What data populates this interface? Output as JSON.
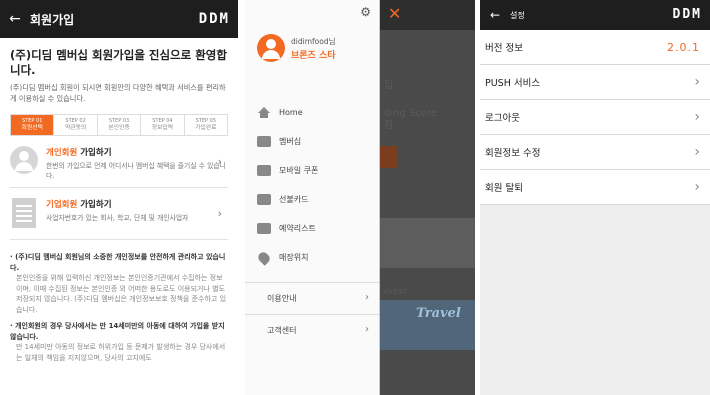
{
  "screen1": {
    "title": "회원가입",
    "logo": "DDM",
    "welcome_title": "(주)디딤 멤버십 회원가입을 진심으로 환영합니다.",
    "welcome_desc": "(주)디딤 멤버십 회원이 되시면 회원만의 다양한 혜택과 서비스를 편리하게 이용하실 수 있습니다.",
    "steps": [
      {
        "num": "STEP 01",
        "label": "회원선택"
      },
      {
        "num": "STEP 02",
        "label": "약관동의"
      },
      {
        "num": "STEP 03",
        "label": "본인인증"
      },
      {
        "num": "STEP 04",
        "label": "정보입력"
      },
      {
        "num": "STEP 05",
        "label": "가입완료"
      }
    ],
    "personal": {
      "hl": "개인회원",
      "rest": " 가입하기",
      "desc": "한번의 가입으로 언제 어디서나 멤버십 혜택을 즐기실 수 있습니다."
    },
    "corporate": {
      "hl": "기업회원",
      "rest": " 가입하기",
      "desc": "사업자번호가 있는 회사, 학교, 단체 및 개인사업자"
    },
    "privacy": [
      {
        "head": "· (주)디딤 멤버십 회원님의 소중한 개인정보를 안전하게 관리하고 있습니다.",
        "text": "본인인증을 위해 입력하신 개인정보는 본인인증기관에서 수집하는 정보이며, 이때 수집된 정보는 본인인증 외 어떠한 용도로도 이용되거나 별도 저장되지 않습니다. (주)디딤 멤버십은 개인정보보호 정책을 준수하고 있습니다."
      },
      {
        "head": "· 개인회원의 경우 당사에서는 만 14세미만의 아동에 대하여 가입을 받지않습니다.",
        "text": "만 14세미만 아동의 정보로 허위가입 등 문제가 발생하는 경우 당사에서는 일체의 책임을 지지않으며, 당사의 고지에도"
      }
    ]
  },
  "screen2": {
    "username": "didimfood님",
    "grade": "브론즈 스타",
    "menu": [
      {
        "label": "Home",
        "icon": "home-icon"
      },
      {
        "label": "멤버십",
        "icon": "membership-card-icon"
      },
      {
        "label": "모바일 쿠폰",
        "icon": "coupon-icon"
      },
      {
        "label": "선불카드",
        "icon": "prepaid-card-icon"
      },
      {
        "label": "예약리스트",
        "icon": "calendar-icon"
      },
      {
        "label": "매장위치",
        "icon": "location-pin-icon"
      }
    ],
    "submenu": [
      {
        "label": "이용안내"
      },
      {
        "label": "고객센터"
      }
    ],
    "behind": {
      "t1": "딥",
      "t2": "ding Score",
      "t3": "점",
      "travel": "Travel",
      "event": "EVENT"
    }
  },
  "screen3": {
    "title": "설정",
    "logo": "DDM",
    "rows": [
      {
        "label": "버전 정보",
        "value": "2.0.1"
      },
      {
        "label": "PUSH 서비스"
      },
      {
        "label": "로그아웃"
      },
      {
        "label": "회원정보 수정"
      },
      {
        "label": "회원 탈퇴"
      }
    ]
  }
}
